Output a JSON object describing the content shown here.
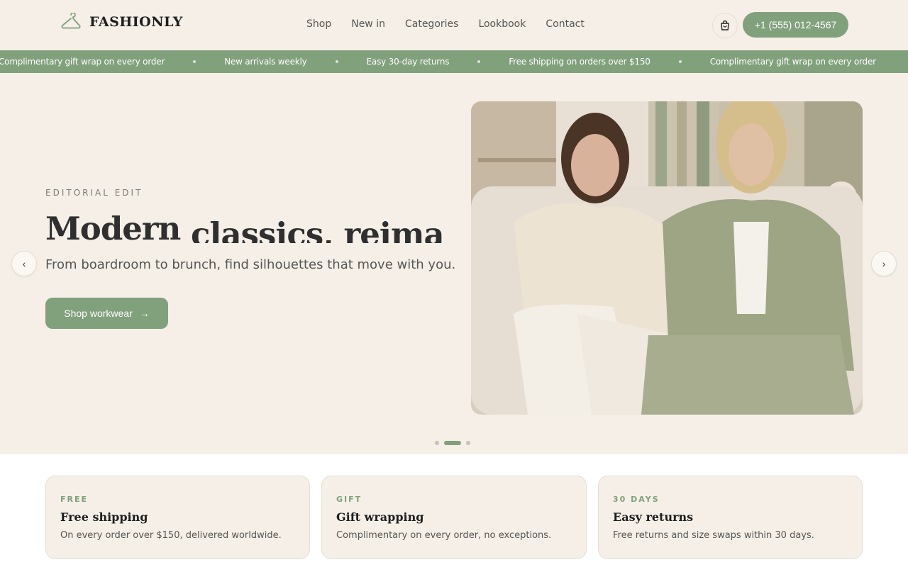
{
  "header": {
    "brand": "FASHIONLY",
    "nav": [
      "Shop",
      "New in",
      "Categories",
      "Lookbook",
      "Contact"
    ],
    "cart_icon": "shopping-bag-icon",
    "phone": "+1 (555) 012-4567"
  },
  "marquee": {
    "items": [
      "Complimentary gift wrap on every order",
      "New arrivals weekly",
      "Easy 30-day returns",
      "Free shipping on orders over $150",
      "Complimentary gift wrap on every order"
    ]
  },
  "hero": {
    "eyebrow": "EDITORIAL EDIT",
    "title_part1": "Modern ",
    "title_part2": "classics, reimagined",
    "subtitle": "From boardroom to brunch, find silhouettes that move with you.",
    "cta": "Shop workwear",
    "cta_arrow": "→",
    "prev_icon": "‹",
    "next_icon": "›",
    "slides_count": 3,
    "active_slide": 2
  },
  "features": [
    {
      "tag": "FREE",
      "title": "Free shipping",
      "desc": "On every order over $150, delivered worldwide."
    },
    {
      "tag": "GIFT",
      "title": "Gift wrapping",
      "desc": "Complimentary on every order, no exceptions."
    },
    {
      "tag": "30 DAYS",
      "title": "Easy returns",
      "desc": "Free returns and size swaps within 30 days."
    }
  ],
  "colors": {
    "accent": "#81a07c",
    "background": "#f5efe7",
    "text": "#3a3a3a"
  }
}
